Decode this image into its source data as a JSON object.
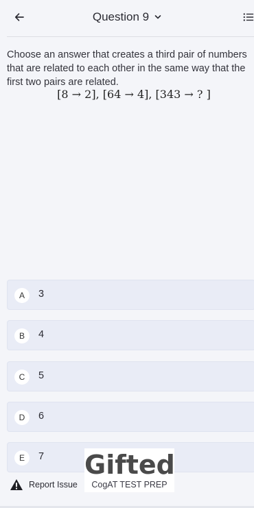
{
  "header": {
    "title": "Question 9",
    "back_icon": "arrow-left-icon",
    "dropdown_icon": "chevron-down-icon",
    "list_icon": "list-icon"
  },
  "question": {
    "text": "Choose an answer that creates a third pair of numbers that are related to each other in the same way that the first two pairs are related.",
    "equation": "[8 → 2], [64 → 4], [343 → ? ]"
  },
  "options": [
    {
      "letter": "A",
      "value": "3"
    },
    {
      "letter": "B",
      "value": "4"
    },
    {
      "letter": "C",
      "value": "5"
    },
    {
      "letter": "D",
      "value": "6"
    },
    {
      "letter": "E",
      "value": "7"
    }
  ],
  "footer": {
    "report_label": "Report Issue",
    "report_icon": "warning-icon"
  },
  "brand": {
    "logo_text": "Gifted",
    "subtitle": "CogAT TEST PREP"
  },
  "colors": {
    "background": "#f4f5f9",
    "option_bg": "#e9ecf6",
    "text": "#2b2b33"
  }
}
